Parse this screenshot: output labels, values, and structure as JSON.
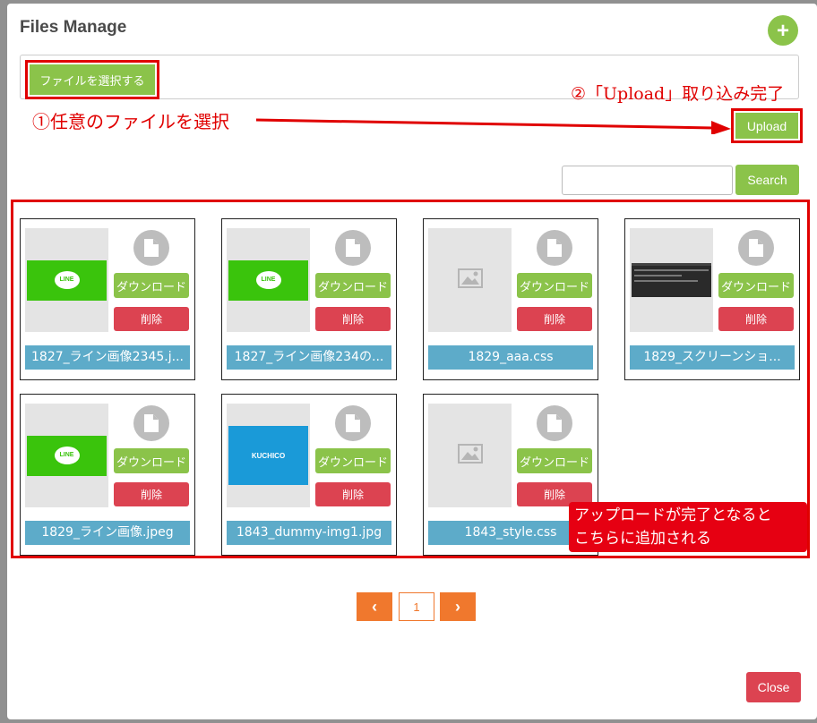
{
  "modal": {
    "title": "Files Manage",
    "add_icon": "plus-icon",
    "choose_file_label": "ファイルを選択する",
    "upload_label": "Upload",
    "search_placeholder": "",
    "search_label": "Search",
    "close_label": "Close"
  },
  "annotations": {
    "step1": "①任意のファイルを選択",
    "step2": "②「Upload」取り込み完了",
    "callout_line1": "アップロードが完了となると",
    "callout_line2": "こちらに追加される"
  },
  "files": [
    {
      "name": "1827_ライン画像2345.j...",
      "thumb": "line",
      "download_label": "ダウンロード",
      "delete_label": "削除"
    },
    {
      "name": "1827_ライン画像234の...",
      "thumb": "line",
      "download_label": "ダウンロード",
      "delete_label": "削除"
    },
    {
      "name": "1829_aaa.css",
      "thumb": "placeholder",
      "download_label": "ダウンロード",
      "delete_label": "削除"
    },
    {
      "name": "1829_スクリーンショ...",
      "thumb": "screenshot",
      "download_label": "ダウンロード",
      "delete_label": "削除"
    },
    {
      "name": "1829_ライン画像.jpeg",
      "thumb": "line",
      "download_label": "ダウンロード",
      "delete_label": "削除"
    },
    {
      "name": "1843_dummy-img1.jpg",
      "thumb": "kuchico",
      "download_label": "ダウンロード",
      "delete_label": "削除"
    },
    {
      "name": "1843_style.css",
      "thumb": "placeholder",
      "download_label": "ダウンロード",
      "delete_label": "削除"
    }
  ],
  "thumb_text": {
    "line": "LINE",
    "kuchico": "KUCHICO"
  },
  "pagination": {
    "prev": "‹",
    "current": "1",
    "next": "›"
  },
  "colors": {
    "green": "#8bc34a",
    "red": "#dc4351",
    "blue": "#5dabc9",
    "orange": "#f0782d",
    "annotation": "#e00000"
  }
}
